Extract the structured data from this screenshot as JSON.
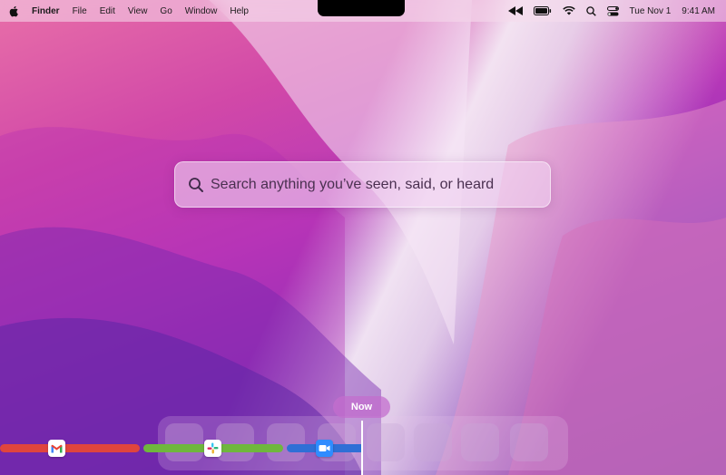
{
  "menubar": {
    "apple_icon": "apple-logo-icon",
    "app_name": "Finder",
    "menus": [
      "File",
      "Edit",
      "View",
      "Go",
      "Window",
      "Help"
    ],
    "status": {
      "icons": [
        "rewind-icon",
        "battery-icon",
        "wifi-icon",
        "spotlight-search-icon",
        "control-center-icon"
      ],
      "date": "Tue Nov 1",
      "time": "9:41 AM"
    }
  },
  "search": {
    "icon": "search-icon",
    "placeholder": "Search anything you’ve seen, said, or heard"
  },
  "timeline": {
    "now_label": "Now",
    "apps": [
      {
        "name": "Gmail",
        "icon": "gmail-icon",
        "color": "#e0453d"
      },
      {
        "name": "Slack",
        "icon": "slack-icon",
        "color": "#6fb73d"
      },
      {
        "name": "Zoom",
        "icon": "zoom-icon",
        "color": "#2f6fd6"
      }
    ]
  },
  "colors": {
    "wallpaper_top": "#e86fa8",
    "wallpaper_mid": "#b838b8",
    "wallpaper_bottom": "#5b28a8",
    "now_pill": "#c36ecd"
  }
}
